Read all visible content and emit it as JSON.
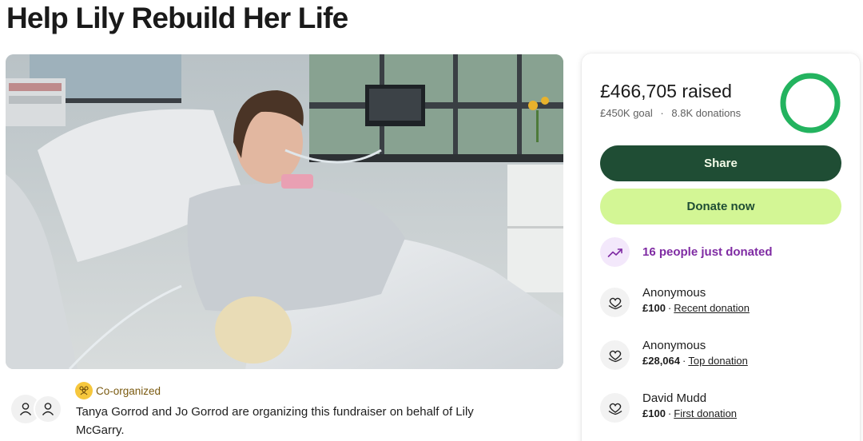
{
  "page": {
    "title": "Help Lily Rebuild Her Life"
  },
  "organizer": {
    "badge_label": "Co-organized",
    "description": "Tanya Gorrod and Jo Gorrod are organizing this fundraiser on behalf of Lily McGarry."
  },
  "summary": {
    "raised_text": "£466,705 raised",
    "goal_text": "£450K goal",
    "separator": "·",
    "donations_text": "8.8K donations",
    "progress_fraction": 1.0,
    "ring_color": "#23b35f",
    "ring_track_color": "#d9f2c9"
  },
  "actions": {
    "share_label": "Share",
    "donate_label": "Donate now"
  },
  "activity": {
    "recent_text": "16 people just donated"
  },
  "donations": [
    {
      "name": "Anonymous",
      "amount": "£100",
      "separator": "·",
      "tag": "Recent donation"
    },
    {
      "name": "Anonymous",
      "amount": "£28,064",
      "separator": "·",
      "tag": "Top donation"
    },
    {
      "name": "David Mudd",
      "amount": "£100",
      "separator": "·",
      "tag": "First donation"
    }
  ],
  "colors": {
    "primary_dark": "#1f4d34",
    "accent_lime": "#d3f695",
    "purple": "#7f2ba3"
  },
  "icons": {
    "coorg": "people-icon",
    "trend": "trending-up-icon",
    "donation": "heart-hand-icon",
    "avatar": "person-icon"
  }
}
